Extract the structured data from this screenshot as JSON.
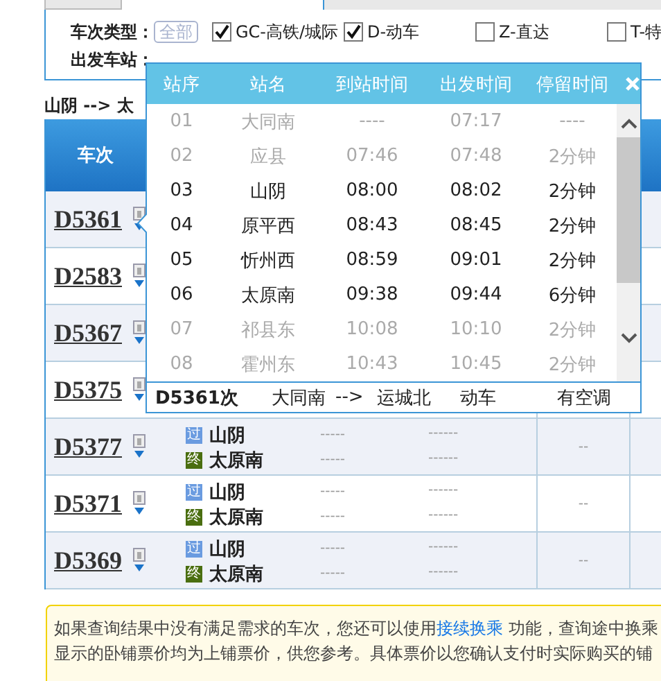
{
  "filters": [
    {
      "label": "车次类型：",
      "all_button": {
        "label": "全部",
        "selected": false
      },
      "options": [
        {
          "label": "GC-高铁/城际",
          "checked": true
        },
        {
          "label": "D-动车",
          "checked": true
        },
        {
          "label": "Z-直达",
          "checked": false
        },
        {
          "label": "T-特",
          "checked": false
        }
      ]
    },
    {
      "label": "出发车站："
    }
  ],
  "route": "山阴 --> 太",
  "table": {
    "columns": [
      "车次"
    ],
    "rows": [
      {
        "train": "D5361"
      },
      {
        "train": "D2583"
      },
      {
        "train": "D5367"
      },
      {
        "train": "D5375"
      },
      {
        "train": "D5377",
        "stops": [
          {
            "kind": "pass",
            "badge": "过",
            "station": "山阴",
            "time_1": "-----",
            "time_2": "------"
          },
          {
            "kind": "terminal",
            "badge": "终",
            "station": "太原南",
            "time_1": "-----",
            "time_2": "------"
          }
        ],
        "column_5": "--"
      },
      {
        "train": "D5371",
        "stops": [
          {
            "kind": "pass",
            "badge": "过",
            "station": "山阴",
            "time_1": "-----",
            "time_2": "------"
          },
          {
            "kind": "terminal",
            "badge": "终",
            "station": "太原南",
            "time_1": "-----",
            "time_2": "------"
          }
        ],
        "column_5": "--"
      },
      {
        "train": "D5369",
        "stops": [
          {
            "kind": "pass",
            "badge": "过",
            "station": "山阴",
            "time_1": "-----",
            "time_2": "------"
          },
          {
            "kind": "terminal",
            "badge": "终",
            "station": "太原南",
            "time_1": "-----",
            "time_2": "------"
          }
        ],
        "column_5": "--"
      }
    ]
  },
  "popup": {
    "columns": [
      "站序",
      "站名",
      "到站时间",
      "出发时间",
      "停留时间"
    ],
    "rows": [
      {
        "no": "01",
        "station": "大同南",
        "arrive": "----",
        "depart": "07:17",
        "stay": "----",
        "active": false
      },
      {
        "no": "02",
        "station": "应县",
        "arrive": "07:46",
        "depart": "07:48",
        "stay": "2分钟",
        "active": false
      },
      {
        "no": "03",
        "station": "山阴",
        "arrive": "08:00",
        "depart": "08:02",
        "stay": "2分钟",
        "active": true
      },
      {
        "no": "04",
        "station": "原平西",
        "arrive": "08:43",
        "depart": "08:45",
        "stay": "2分钟",
        "active": true
      },
      {
        "no": "05",
        "station": "忻州西",
        "arrive": "08:59",
        "depart": "09:01",
        "stay": "2分钟",
        "active": true
      },
      {
        "no": "06",
        "station": "太原南",
        "arrive": "09:38",
        "depart": "09:44",
        "stay": "6分钟",
        "active": true
      },
      {
        "no": "07",
        "station": "祁县东",
        "arrive": "10:08",
        "depart": "10:10",
        "stay": "2分钟",
        "active": false
      },
      {
        "no": "08",
        "station": "霍州东",
        "arrive": "10:43",
        "depart": "10:45",
        "stay": "2分钟",
        "active": false
      }
    ],
    "footer": {
      "train": "D5361次",
      "from": "大同南",
      "arrow": "-->",
      "to": "运城北",
      "type": "动车",
      "ac": "有空调"
    }
  },
  "notice": [
    [
      {
        "kind": "text",
        "text": "如果查询结果中没有满足需求的车次，您还可以使用"
      },
      {
        "kind": "link",
        "text": "接续换乘"
      },
      {
        "kind": "text",
        "text": " 功能，查询途中换乘"
      }
    ],
    [
      {
        "kind": "text",
        "text": "显示的卧铺票价均为上铺票价，供您参考。具体票价以您确认支付时实际购买的铺"
      }
    ]
  ]
}
